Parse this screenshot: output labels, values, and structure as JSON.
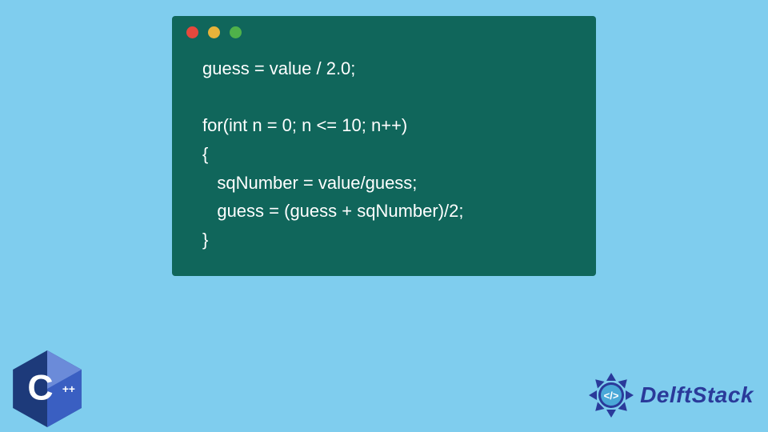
{
  "code": {
    "lines": [
      "guess = value / 2.0;",
      "",
      "for(int n = 0; n <= 10; n++)",
      "{",
      "   sqNumber = value/guess;",
      "   guess = (guess + sqNumber)/2;",
      "}"
    ]
  },
  "window": {
    "dot_colors": {
      "red": "#e6483d",
      "yellow": "#e8b33a",
      "green": "#4fb24a"
    },
    "bg": "#10665b"
  },
  "page": {
    "bg": "#7fcdee"
  },
  "cpp_logo": {
    "label": "C",
    "plus": "++",
    "color_dark": "#1d3a7a",
    "color_light": "#3a5fc2"
  },
  "delft": {
    "text": "DelftStack",
    "badge_color": "#2a3a9a"
  }
}
